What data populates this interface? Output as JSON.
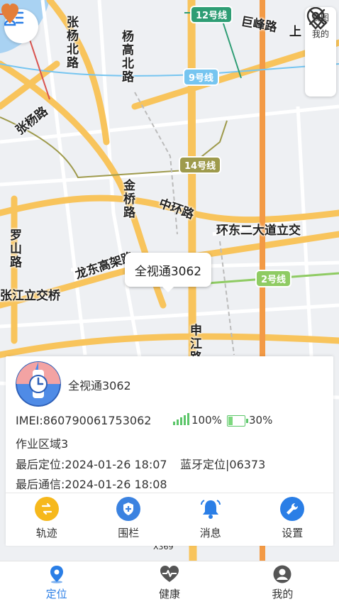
{
  "map": {
    "roads": {
      "zhangyang_north": "张杨北路",
      "yanggao_north": "杨高北路",
      "zhangyang": "张杨路",
      "jufeng": "巨峰路",
      "shang": "上",
      "jinqiao": "金桥路",
      "middle_ring": "中环路",
      "east_second_ave": "环东二大道立交",
      "luoshan": "罗山路",
      "longdong": "龙东高架路",
      "zhangjiang_interchange": "张江立交桥",
      "shenjiang": "申江路",
      "x369": "X369"
    },
    "metro": [
      {
        "label": "12号线",
        "color": "#2e9d74"
      },
      {
        "label": "9号线",
        "color": "#76c5f0"
      },
      {
        "label": "14号线",
        "color": "#9e9a4c"
      },
      {
        "label": "2号线",
        "color": "#8fcb63"
      }
    ]
  },
  "tools": {
    "view_label": "视图",
    "mine_label": "我的"
  },
  "marker": {
    "callout": "全视通3062"
  },
  "device": {
    "name": "全视通3062",
    "imei": "IMEI:860790061753062",
    "signal": "100%",
    "battery": "30%",
    "battery_level": 0.3,
    "zone": "作业区域3",
    "last_location": "最后定位:2024-01-26 18:07",
    "bluetooth": "蓝牙定位|06373",
    "last_comm": "最后通信:2024-01-26 18:08"
  },
  "actions": [
    {
      "label": "轨迹",
      "color": "#f6b81c",
      "icon": "track-icon"
    },
    {
      "label": "围栏",
      "color": "#3b82e0",
      "icon": "fence-icon"
    },
    {
      "label": "消息",
      "color": "#2a7ee6",
      "icon": "bell-icon"
    },
    {
      "label": "设置",
      "color": "#2a7ee6",
      "icon": "wrench-icon"
    }
  ],
  "tabs": [
    {
      "label": "定位",
      "active": true,
      "icon": "location-pin-icon"
    },
    {
      "label": "健康",
      "active": false,
      "icon": "heart-pulse-icon"
    },
    {
      "label": "我的",
      "active": false,
      "icon": "person-icon"
    }
  ],
  "colors": {
    "accent": "#2a7ee6",
    "road_major": "#f8c45c",
    "road_express": "#f39a45",
    "signal": "#5cc66a"
  }
}
